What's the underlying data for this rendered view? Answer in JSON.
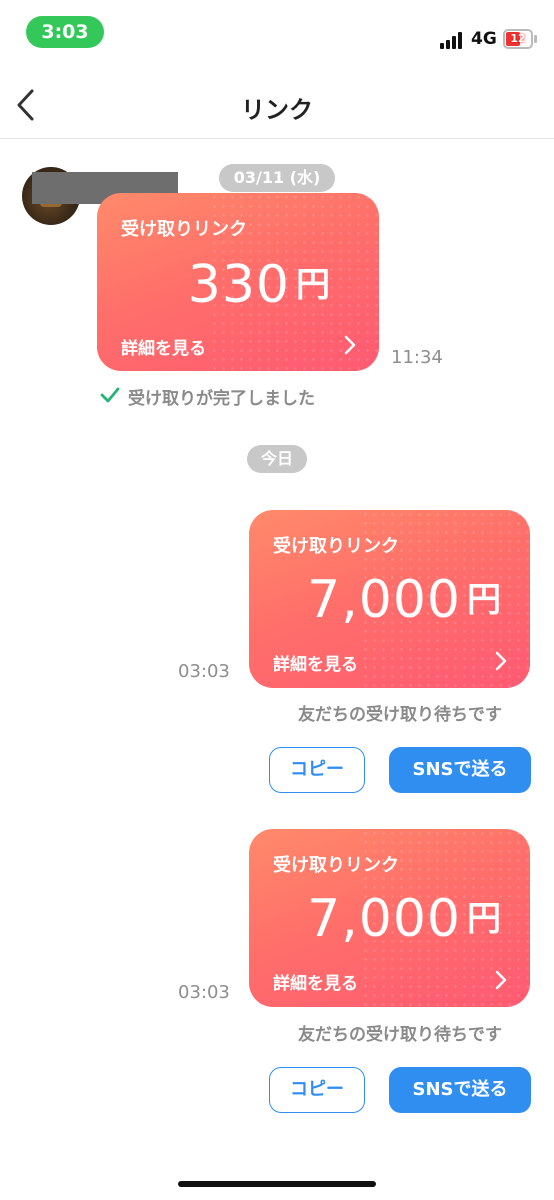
{
  "status_bar": {
    "time": "3:03",
    "network": "4G",
    "battery": "12"
  },
  "nav": {
    "title": "リンク",
    "back_icon": "chevron-left-icon"
  },
  "dates": {
    "first": "03/11 (水)",
    "today": "今日"
  },
  "received_message": {
    "card_title": "受け取りリンク",
    "amount": "330",
    "currency": "円",
    "detail_label": "詳細を見る",
    "time": "11:34",
    "status": "受け取りが完了しました"
  },
  "sent_messages": [
    {
      "card_title": "受け取りリンク",
      "amount": "7,000",
      "currency": "円",
      "detail_label": "詳細を見る",
      "time": "03:03",
      "status": "友だちの受け取り待ちです",
      "copy_label": "コピー",
      "sns_label": "SNSで送る"
    },
    {
      "card_title": "受け取りリンク",
      "amount": "7,000",
      "currency": "円",
      "detail_label": "詳細を見る",
      "time": "03:03",
      "status": "友だちの受け取り待ちです",
      "copy_label": "コピー",
      "sns_label": "SNSで送る"
    }
  ],
  "colors": {
    "accent_blue": "#2f8ef0",
    "card_gradient_start": "#ff8a6a",
    "card_gradient_end": "#ff5a72",
    "status_green": "#34c759",
    "check_green": "#22b573"
  }
}
